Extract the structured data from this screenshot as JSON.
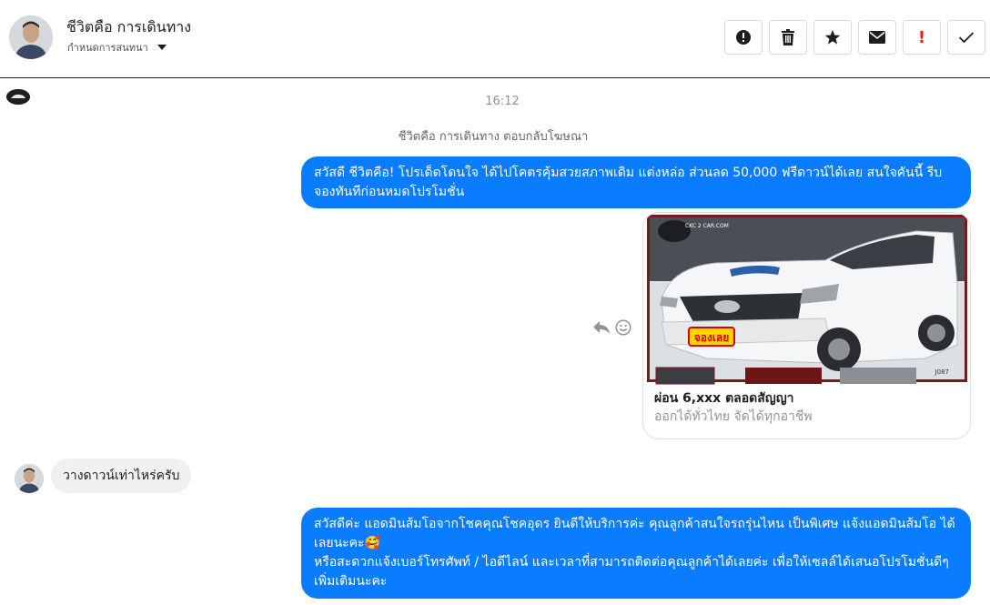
{
  "header": {
    "name": "ชีวิตคือ การเดินทาง",
    "subtitle": "กำหนดการสนทนา",
    "actions": [
      "info-icon",
      "trash-icon",
      "star-icon",
      "mail-icon",
      "exclamation-icon",
      "check-icon"
    ],
    "excl_glyph": "!"
  },
  "conversation": {
    "time": "16:12",
    "note": "ชีวิตคือ การเดินทาง ตอบกลับโฆษณา",
    "msg1": "สวัสดี ชีวิตคือ! โปรเด็ดโดนใจ ได้ไปโคตรคุ้มสวยสภาพเดิม แต่งหล่อ  ส่วนลด 50,000 ฟรีดาวน์ได้เลย  สนใจคันนี้ รีบจองทันทีก่อนหมดโปรโมชั่น",
    "card": {
      "title": "ผ่อน 6,xxx ตลอดสัญญา",
      "subtitle": "ออกได้ทั่วไทย จัดได้ทุกอาชีพ",
      "image_badge": "จองเลย",
      "image_code": "J087",
      "image_watermark": "CKC 2 CAR.COM"
    },
    "msg_in": "วางดาวน์เท่าไหร่ครับ",
    "msg2": "สวัสดีค่ะ แอดมินส้มโอจากโชคคุณโชคอุดร ยินดีให้บริการค่ะ   คุณลูกค้าสนใจรถรุ่นไหน เป็นพิเศษ แจ้งแอดมินส้มโอ ได้เลยนะคะ🥰\nหรือสะดวกแจ้งเบอร์โทรศัพท์ / ไอดีไลน์ และเวลาที่สามารถติดต่อคุณลูกค้าได้เลยค่ะ เพื่อให้เซลล์ได้เสนอโปรโมชั่นดีๆเพิ่มเติมนะคะ"
  },
  "colors": {
    "accent": "#0a7cff",
    "incoming": "#f1f0f0",
    "danger": "#e02020"
  }
}
